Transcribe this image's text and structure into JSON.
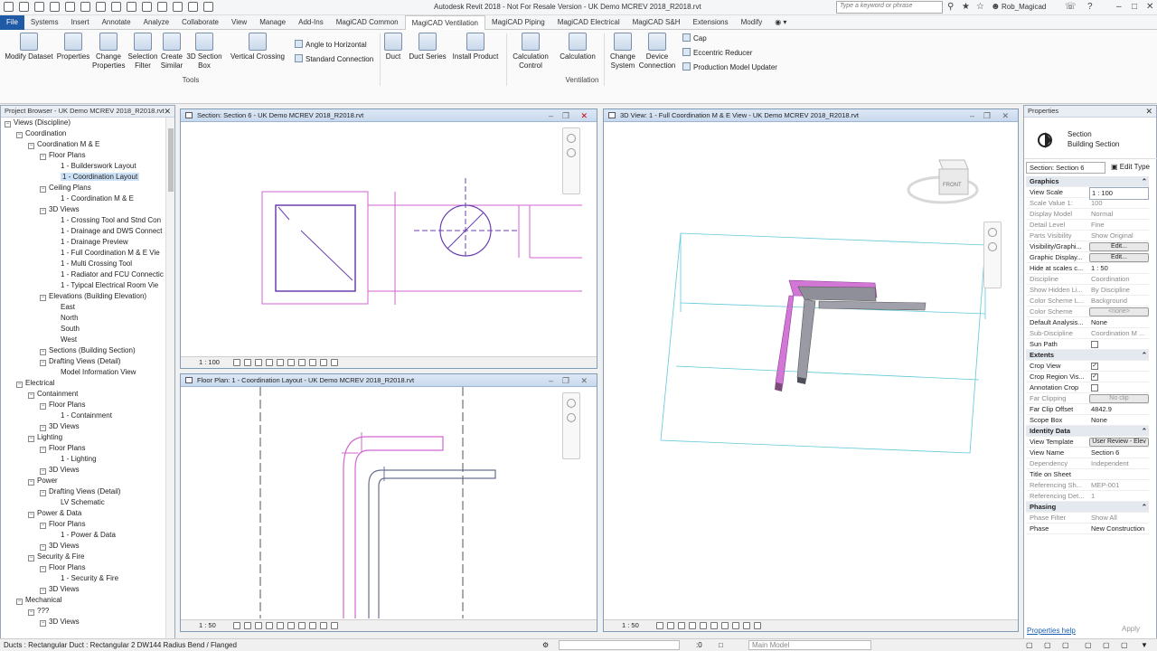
{
  "app": {
    "title": "Autodesk Revit 2018 - Not For Resale Version -    UK Demo MCREV 2018_R2018.rvt"
  },
  "search": {
    "placeholder": "Type a keyword or phrase"
  },
  "user": {
    "name": "Rob_Magicad"
  },
  "menu_tabs": [
    "File",
    "Systems",
    "Insert",
    "Annotate",
    "Analyze",
    "Collaborate",
    "View",
    "Manage",
    "Add-Ins",
    "MagiCAD Common",
    "MagiCAD Ventilation",
    "MagiCAD Piping",
    "MagiCAD Electrical",
    "MagiCAD S&H",
    "Extensions",
    "Modify"
  ],
  "ribbon": {
    "buttons": [
      "Modify Dataset",
      "Properties",
      "Change Properties",
      "Selection Filter",
      "Create Similar",
      "3D Section Box",
      "Vertical Crossing",
      "Duct",
      "Duct Series",
      "Install Product",
      "Calculation Control",
      "Calculation",
      "Change System",
      "Device Connection"
    ],
    "small": [
      "Angle to Horizontal",
      "Standard Connection",
      "Cap",
      "Eccentric Reducer",
      "Production Model Updater"
    ],
    "groups": [
      "Tools",
      "Ventilation"
    ]
  },
  "project_browser": {
    "title": "Project Browser - UK Demo MCREV 2018_R2018.rvt",
    "rows": [
      "Views (Discipline)",
      "Coordination",
      "Coordination M & E",
      "Floor Plans",
      "1 - Builderswork Layout",
      "1 - Coordination Layout",
      "Ceiling Plans",
      "1 - Coordination M & E",
      "3D Views",
      "1 - Crossing Tool and Stnd Con",
      "1 - Drainage and DWS Connect",
      "1 - Drainage Preview",
      "1 - Full Coordination M & E Vie",
      "1 - Multi Crossing Tool",
      "1 - Radiator and FCU Connectic",
      "1 - Tyipcal Electrical Room Vie",
      "Elevations (Building Elevation)",
      "East",
      "North",
      "South",
      "West",
      "Sections (Building Section)",
      "Drafting Views (Detail)",
      "Model Information View",
      "Electrical",
      "Containment",
      "Floor Plans",
      "1 - Containment",
      "3D Views",
      "Lighting",
      "Floor Plans",
      "1 - Lighting",
      "3D Views",
      "Power",
      "Drafting Views (Detail)",
      "LV Schematic",
      "Power & Data",
      "Floor Plans",
      "1 - Power & Data",
      "3D Views",
      "Security & Fire",
      "Floor Plans",
      "1 - Security & Fire",
      "3D Views",
      "Mechanical",
      "???",
      "3D Views"
    ]
  },
  "views": {
    "section": {
      "title": "Section: Section 6 - UK Demo MCREV 2018_R2018.rvt",
      "scale": "1 : 100"
    },
    "floor": {
      "title": "Floor Plan: 1 - Coordination Layout - UK Demo MCREV 2018_R2018.rvt",
      "scale": "1 : 50"
    },
    "three_d": {
      "title": "3D View: 1 - Full Coordination M & E View - UK Demo MCREV 2018_R2018.rvt",
      "scale": "1 : 50",
      "viewcube_face": "FRONT"
    }
  },
  "properties": {
    "title": "Properties",
    "type_line1": "Section",
    "type_line2": "Building Section",
    "filter": "Section: Section 6",
    "edit_type": "Edit Type",
    "rows": [
      {
        "k": "Graphics",
        "v": "",
        "sec": true
      },
      {
        "k": "View Scale",
        "v": "1 : 100",
        "box": true
      },
      {
        "k": "Scale Value    1:",
        "v": "100",
        "dim": true
      },
      {
        "k": "Display Model",
        "v": "Normal",
        "dim": true
      },
      {
        "k": "Detail Level",
        "v": "Fine",
        "dim": true
      },
      {
        "k": "Parts Visibility",
        "v": "Show Original",
        "dim": true
      },
      {
        "k": "Visibility/Graphi...",
        "v": "Edit...",
        "btn": true
      },
      {
        "k": "Graphic Display...",
        "v": "Edit...",
        "btn": true
      },
      {
        "k": "Hide at scales c...",
        "v": "1 : 50"
      },
      {
        "k": "Discipline",
        "v": "Coordination",
        "dim": true
      },
      {
        "k": "Show Hidden Li...",
        "v": "By Discipline",
        "dim": true
      },
      {
        "k": "Color Scheme L...",
        "v": "Background",
        "dim": true
      },
      {
        "k": "Color Scheme",
        "v": "<none>",
        "btn": true,
        "dimb": true,
        "dim": true
      },
      {
        "k": "Default Analysis...",
        "v": "None"
      },
      {
        "k": "Sub-Discipline",
        "v": "Coordination M ...",
        "dim": true
      },
      {
        "k": "Sun Path",
        "v": "",
        "chk": true,
        "checked": false
      },
      {
        "k": "Extents",
        "v": "",
        "sec": true
      },
      {
        "k": "Crop View",
        "v": "",
        "chk": true,
        "checked": true
      },
      {
        "k": "Crop Region Vis...",
        "v": "",
        "chk": true,
        "checked": true
      },
      {
        "k": "Annotation Crop",
        "v": "",
        "chk": true,
        "checked": false
      },
      {
        "k": "Far Clipping",
        "v": "No clip",
        "btn": true,
        "dimb": true,
        "dim": true
      },
      {
        "k": "Far Clip Offset",
        "v": "4842.9"
      },
      {
        "k": "Scope Box",
        "v": "None"
      },
      {
        "k": "Identity Data",
        "v": "",
        "sec": true
      },
      {
        "k": "View Template",
        "v": "User Review - Elev",
        "btn": true
      },
      {
        "k": "View Name",
        "v": "Section 6"
      },
      {
        "k": "Dependency",
        "v": "Independent",
        "dim": true
      },
      {
        "k": "Title on Sheet",
        "v": ""
      },
      {
        "k": "Referencing Sh...",
        "v": "MEP-001",
        "dim": true
      },
      {
        "k": "Referencing Det...",
        "v": "1",
        "dim": true
      },
      {
        "k": "Phasing",
        "v": "",
        "sec": true
      },
      {
        "k": "Phase Filter",
        "v": "Show All",
        "dim": true
      },
      {
        "k": "Phase",
        "v": "New Construction"
      }
    ],
    "help": "Properties help",
    "apply": "Apply"
  },
  "status": {
    "text": "Ducts : Rectangular Duct : Rectangular 2 DW144 Radius Bend / Flanged",
    "zero": ":0",
    "model": "Main Model"
  }
}
